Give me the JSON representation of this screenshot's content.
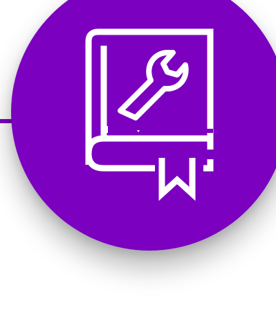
{
  "icon": {
    "name": "book-wrench-icon",
    "description_role": "manual"
  },
  "colors": {
    "accent": "#7b00bf",
    "icon": "#ffffff",
    "background": "#ffffff"
  }
}
